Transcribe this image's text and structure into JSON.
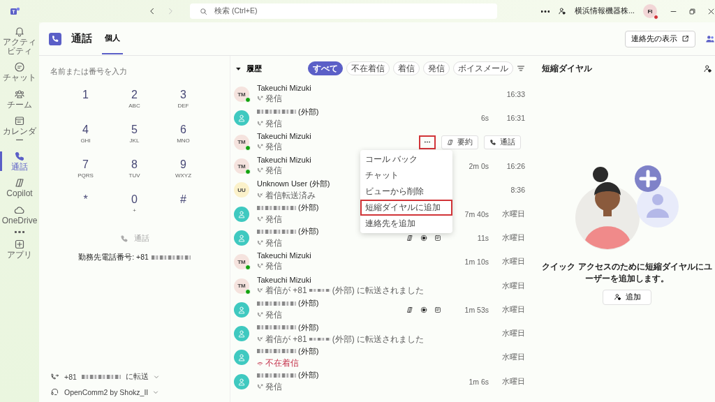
{
  "app": {
    "search_placeholder": "検索 (Ctrl+E)",
    "org": "横浜情報機器株...",
    "avatar": "FI"
  },
  "rail": [
    {
      "label": "アクティビティ",
      "selected": false
    },
    {
      "label": "チャット",
      "selected": false
    },
    {
      "label": "チーム",
      "selected": false
    },
    {
      "label": "カレンダー",
      "selected": false
    },
    {
      "label": "通話",
      "selected": true
    },
    {
      "label": "Copilot",
      "selected": false
    },
    {
      "label": "OneDrive",
      "selected": false
    },
    {
      "selected": false
    },
    {
      "label": "アプリ",
      "selected": false
    }
  ],
  "header": {
    "title": "通話",
    "tabs": [
      {
        "label": "個人",
        "selected": true
      }
    ],
    "contacts_button": "連絡先の表示"
  },
  "dialpad": {
    "placeholder": "名前または番号を入力",
    "keys": [
      {
        "digit": "1"
      },
      {
        "digit": "2",
        "letters": "ABC"
      },
      {
        "digit": "3",
        "letters": "DEF"
      },
      {
        "digit": "4",
        "letters": "GHI"
      },
      {
        "digit": "5",
        "letters": "JKL"
      },
      {
        "digit": "6",
        "letters": "MNO"
      },
      {
        "digit": "7",
        "letters": "PQRS"
      },
      {
        "digit": "8",
        "letters": "TUV"
      },
      {
        "digit": "9",
        "letters": "WXYZ"
      },
      {
        "digit": "*"
      },
      {
        "digit": "0",
        "letters": "+"
      },
      {
        "digit": "#"
      }
    ],
    "call_button": {
      "label": "通話",
      "disabled": true
    },
    "work_number": "勤務先電話番号: +81",
    "forward_prefix": "+81",
    "forward_suffix": "に転送",
    "device": "OpenComm2 by Shokz_II"
  },
  "history": {
    "title": "履歴",
    "expanded": true,
    "filters": [
      {
        "label": "すべて",
        "selected": true
      },
      {
        "label": "不在着信",
        "selected": false
      },
      {
        "label": "着信",
        "selected": false
      },
      {
        "label": "発信",
        "selected": false
      },
      {
        "label": "ボイスメール",
        "selected": false
      }
    ],
    "rows": [
      {
        "kind": "initials",
        "initials": "TM",
        "color": "#f5e3de",
        "presence": true,
        "name": "Takeuchi Mizuki",
        "redacted": false,
        "forwarded": false,
        "missed": false,
        "detail": "発信",
        "time": "16:33",
        "media": false,
        "hovered": false
      },
      {
        "kind": "person",
        "color": "#3fc9c0",
        "presence": false,
        "name": "(外部)",
        "redacted": true,
        "forwarded": false,
        "missed": false,
        "detail": "発信",
        "duration": "6s",
        "time": "16:31",
        "media": false,
        "hovered": false
      },
      {
        "kind": "initials",
        "initials": "TM",
        "color": "#f5e3de",
        "presence": true,
        "name": "Takeuchi Mizuki",
        "redacted": false,
        "forwarded": false,
        "missed": false,
        "detail": "発信",
        "media": false,
        "hovered": true,
        "actions": [
          "要約",
          "通話"
        ]
      },
      {
        "kind": "initials",
        "initials": "TM",
        "color": "#f5e3de",
        "presence": true,
        "name": "Takeuchi Mizuki",
        "redacted": false,
        "forwarded": false,
        "missed": false,
        "detail": "発信",
        "duration": "2m 0s",
        "time": "16:26",
        "media": false,
        "hovered": false
      },
      {
        "kind": "initials",
        "initials": "UU",
        "color": "#fbf1c9",
        "presence": false,
        "name": "Unknown User (外部)",
        "redacted": false,
        "forwarded": true,
        "missed": false,
        "detail": "着信転送済み",
        "time": "8:36",
        "media": false,
        "hovered": false
      },
      {
        "kind": "person",
        "color": "#3fc9c0",
        "presence": false,
        "name": "(外部)",
        "redacted": true,
        "forwarded": false,
        "missed": false,
        "detail": "発信",
        "duration": "7m 40s",
        "time": "水曜日",
        "media": false,
        "hovered": false
      },
      {
        "kind": "person",
        "color": "#3fc9c0",
        "presence": false,
        "name": "(外部)",
        "redacted": true,
        "forwarded": false,
        "missed": false,
        "detail": "発信",
        "duration": "11s",
        "time": "水曜日",
        "media": true,
        "hovered": false
      },
      {
        "kind": "initials",
        "initials": "TM",
        "color": "#f5e3de",
        "presence": true,
        "name": "Takeuchi Mizuki",
        "redacted": false,
        "forwarded": false,
        "missed": false,
        "detail": "発信",
        "duration": "1m 10s",
        "time": "水曜日",
        "media": false,
        "hovered": false
      },
      {
        "kind": "initials",
        "initials": "TM",
        "color": "#f5e3de",
        "presence": true,
        "name": "Takeuchi Mizuki",
        "redacted": false,
        "forwarded": true,
        "missed": false,
        "detail": "着信が +81",
        "detail_suffix": "(外部) に転送されました",
        "time": "水曜日",
        "media": false,
        "hovered": false
      },
      {
        "kind": "person",
        "color": "#3fc9c0",
        "presence": false,
        "name": "(外部)",
        "redacted": true,
        "forwarded": false,
        "missed": false,
        "detail": "発信",
        "duration": "1m 53s",
        "time": "水曜日",
        "media": true,
        "hovered": false
      },
      {
        "kind": "person",
        "color": "#3fc9c0",
        "presence": false,
        "name": "(外部)",
        "redacted": true,
        "forwarded": true,
        "missed": false,
        "detail": "着信が +81",
        "detail_suffix": "(外部) に転送されました",
        "time": "水曜日",
        "media": false,
        "hovered": false
      },
      {
        "kind": "person",
        "color": "#3fc9c0",
        "presence": false,
        "name": "(外部)",
        "redacted": true,
        "forwarded": false,
        "missed": true,
        "detail": "不在着信",
        "time": "水曜日",
        "media": false,
        "hovered": false
      },
      {
        "kind": "person",
        "color": "#3fc9c0",
        "presence": false,
        "name": "(外部)",
        "redacted": true,
        "forwarded": false,
        "missed": false,
        "detail": "発信",
        "duration": "1m 6s",
        "time": "水曜日",
        "media": false,
        "hovered": false
      }
    ],
    "menu": [
      {
        "label": "コール バック",
        "highlighted": false
      },
      {
        "label": "チャット",
        "highlighted": false
      },
      {
        "label": "ビューから削除",
        "highlighted": false
      },
      {
        "label": "短縮ダイヤルに追加",
        "highlighted": true
      },
      {
        "label": "連絡先を追加",
        "highlighted": false
      }
    ],
    "more_highlighted": true
  },
  "speed_dial": {
    "title": "短縮ダイヤル",
    "message": "クイック アクセスのために短縮ダイヤルにユーザーを追加します。",
    "add_button": "追加"
  }
}
